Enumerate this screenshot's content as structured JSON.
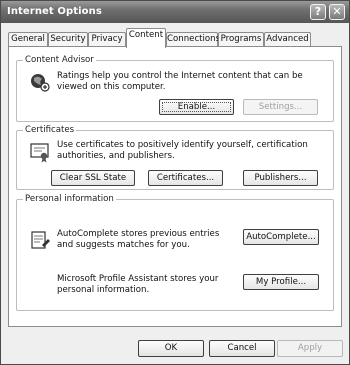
{
  "window": {
    "title": "Internet Options"
  },
  "titlebar": {
    "help_label": "?",
    "close_label": "✕"
  },
  "tabs": [
    {
      "label": "General",
      "active": false
    },
    {
      "label": "Security",
      "active": false
    },
    {
      "label": "Privacy",
      "active": false
    },
    {
      "label": "Content",
      "active": true
    },
    {
      "label": "Connections",
      "active": false
    },
    {
      "label": "Programs",
      "active": false
    },
    {
      "label": "Advanced",
      "active": false
    }
  ],
  "content_advisor": {
    "legend": "Content Advisor",
    "description": "Ratings help you control the Internet content that can be viewed on this computer.",
    "enable_label": "Enable...",
    "settings_label": "Settings..."
  },
  "certificates": {
    "legend": "Certificates",
    "description": "Use certificates to positively identify yourself, certification authorities, and publishers.",
    "clear_ssl_label": "Clear SSL State",
    "certificates_label": "Certificates...",
    "publishers_label": "Publishers..."
  },
  "personal_info": {
    "legend": "Personal information",
    "autocomplete_description": "AutoComplete stores previous entries and suggests matches for you.",
    "autocomplete_label": "AutoComplete...",
    "profile_description": "Microsoft Profile Assistant stores your personal information.",
    "my_profile_label": "My Profile..."
  },
  "footer": {
    "ok_label": "OK",
    "cancel_label": "Cancel",
    "apply_label": "Apply"
  }
}
